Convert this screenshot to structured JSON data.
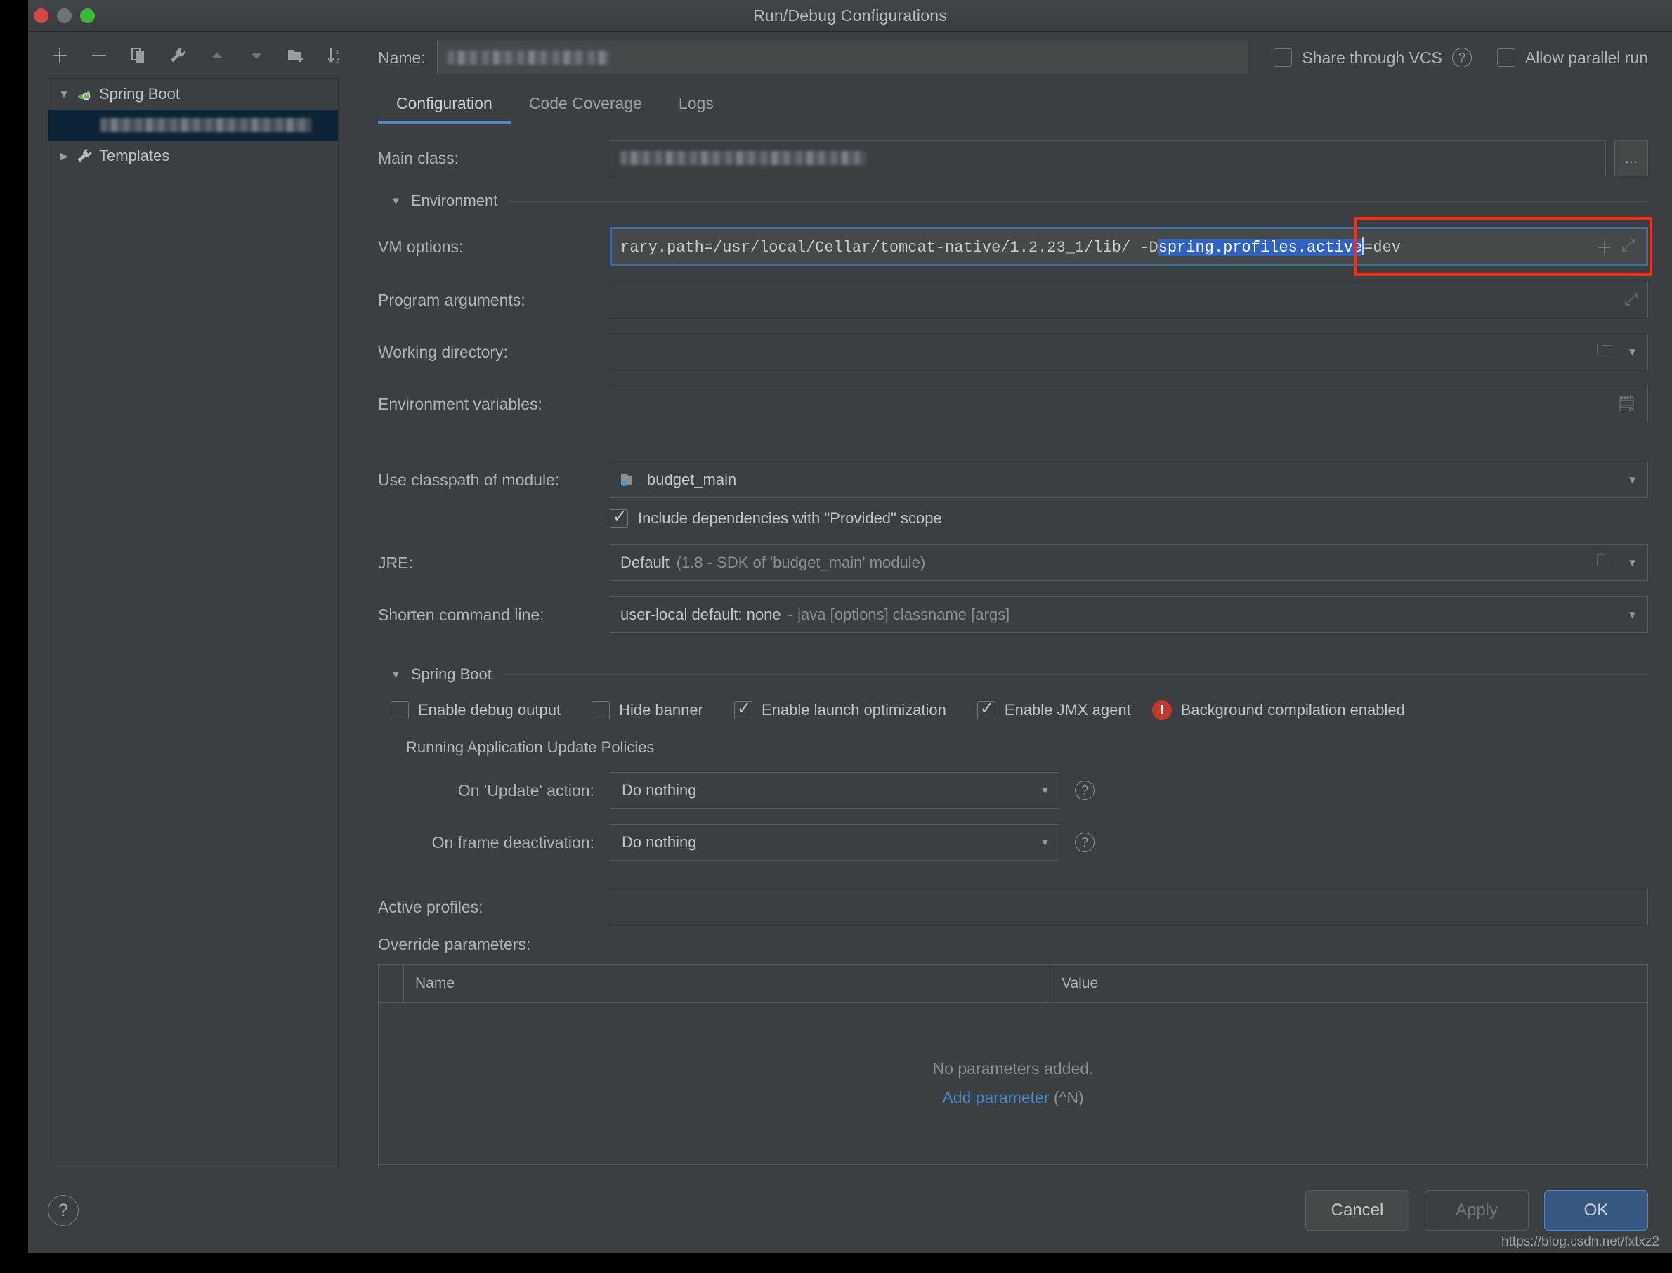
{
  "window": {
    "title": "Run/Debug Configurations",
    "traffic_lights": [
      "close-light",
      "minimize-light",
      "maximize-light"
    ]
  },
  "sidebar": {
    "toolbar": [
      {
        "name": "add-configuration-button",
        "glyph": "+"
      },
      {
        "name": "remove-configuration-button",
        "glyph": "−"
      },
      {
        "name": "copy-configuration-button",
        "glyph": "⧉"
      },
      {
        "name": "edit-templates-button",
        "glyph": "🔧"
      },
      {
        "name": "move-up-button",
        "glyph": "▲"
      },
      {
        "name": "move-down-button",
        "glyph": "▼"
      },
      {
        "name": "new-folder-button",
        "glyph": "🗀"
      },
      {
        "name": "sort-alphabetically-button",
        "glyph": "↓a\nz"
      }
    ],
    "tree": [
      {
        "label": "Spring Boot",
        "twisty": "▼",
        "icon": "spring-boot-icon",
        "selected": false,
        "redacted": false
      },
      {
        "label": "",
        "twisty": "",
        "icon": "",
        "selected": true,
        "redacted": true
      },
      {
        "label": "Templates",
        "twisty": "▶",
        "icon": "wrench-icon",
        "selected": false,
        "redacted": false
      }
    ]
  },
  "header": {
    "name_label": "Name:",
    "name_value": "",
    "name_redacted": true,
    "share_through_vcs": {
      "label": "Share through VCS",
      "checked": false
    },
    "allow_parallel_run": {
      "label": "Allow parallel run",
      "checked": false
    }
  },
  "tabs": [
    {
      "label": "Configuration",
      "active": true
    },
    {
      "label": "Code Coverage",
      "active": false
    },
    {
      "label": "Logs",
      "active": false
    }
  ],
  "form": {
    "main_class": {
      "label": "Main class:",
      "value": "",
      "redacted": true,
      "browse_label": "..."
    },
    "environment_section": "Environment",
    "vm_options": {
      "label": "VM options:",
      "text_prefix": "rary.path=/usr/local/Cellar/tomcat-native/1.2.23_1/lib/ -D",
      "selected_text": "spring.profiles.active",
      "text_suffix": "=dev",
      "focused": true,
      "annotated": true,
      "annotation_color": "#ff2d16"
    },
    "program_arguments": {
      "label": "Program arguments:",
      "value": ""
    },
    "working_directory": {
      "label": "Working directory:",
      "value": ""
    },
    "environment_variables": {
      "label": "Environment variables:",
      "value": ""
    },
    "use_classpath_of_module": {
      "label": "Use classpath of module:",
      "value": "budget_main"
    },
    "include_provided": {
      "label": "Include dependencies with \"Provided\" scope",
      "checked": true
    },
    "jre": {
      "label": "JRE:",
      "value": "Default",
      "hint": "(1.8 - SDK of 'budget_main' module)"
    },
    "shorten_command_line": {
      "label": "Shorten command line:",
      "value": "user-local default: none",
      "hint": "- java [options] classname [args]"
    }
  },
  "spring_boot": {
    "section_label": "Spring Boot",
    "checks": [
      {
        "label": "Enable debug output",
        "checked": false
      },
      {
        "label": "Hide banner",
        "checked": false
      },
      {
        "label": "Enable launch optimization",
        "checked": true
      },
      {
        "label": "Enable JMX agent",
        "checked": true
      }
    ],
    "warning": {
      "label": "Background compilation enabled",
      "icon": "error-icon",
      "color": "#c0392b"
    },
    "policies": {
      "section_label": "Running Application Update Policies",
      "on_update_action": {
        "label": "On 'Update' action:",
        "value": "Do nothing"
      },
      "on_frame_deactivation": {
        "label": "On frame deactivation:",
        "value": "Do nothing"
      }
    },
    "active_profiles": {
      "label": "Active profiles:",
      "value": ""
    },
    "override_parameters": {
      "label": "Override parameters:",
      "columns": [
        "Name",
        "Value"
      ],
      "rows": [],
      "empty_text": "No parameters added.",
      "add_link": "Add parameter",
      "add_hint": "(^N)",
      "toolbar": [
        {
          "name": "add-parameter-button",
          "glyph": "+",
          "enabled": true
        },
        {
          "name": "remove-parameter-button",
          "glyph": "−",
          "enabled": false
        },
        {
          "name": "move-parameter-up-button",
          "glyph": "▲",
          "enabled": false
        },
        {
          "name": "move-parameter-down-button",
          "glyph": "▼",
          "enabled": false
        }
      ]
    }
  },
  "footer": {
    "help_glyph": "?",
    "cancel_label": "Cancel",
    "apply_label": "Apply",
    "ok_label": "OK",
    "watermark": "https://blog.csdn.net/fxtxz2"
  }
}
